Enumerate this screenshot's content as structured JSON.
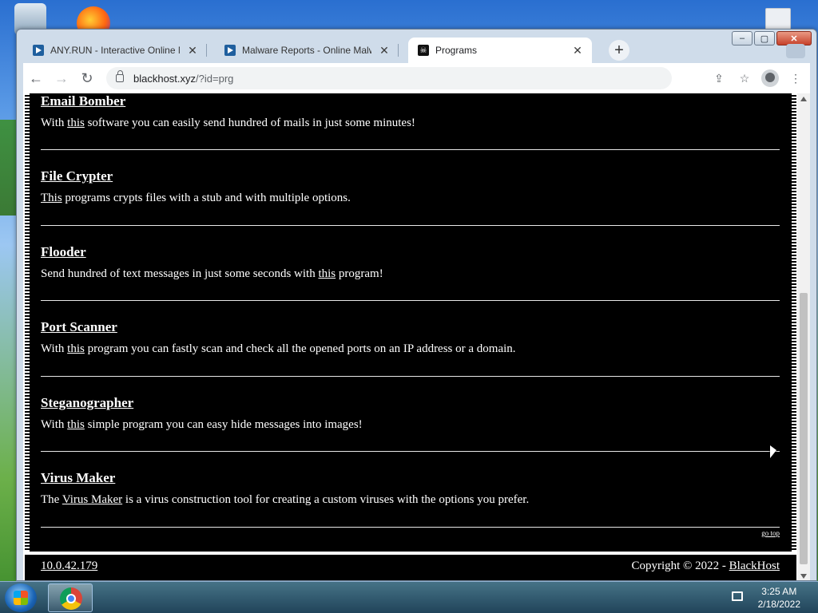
{
  "browser": {
    "tabs": [
      {
        "title": "ANY.RUN - Interactive Online Ma",
        "favicon": "anyrun-icon",
        "active": false
      },
      {
        "title": "Malware Reports - Online Malwa",
        "favicon": "anyrun-icon",
        "active": false
      },
      {
        "title": "Programs",
        "favicon": "pirate-flag-icon",
        "active": true
      }
    ],
    "new_tab_symbol": "+",
    "url_host": "blackhost.xyz",
    "url_path": "/?id=prg",
    "window_controls": {
      "minimize": "–",
      "maximize": "▢",
      "close": "✕"
    }
  },
  "page": {
    "entries": [
      {
        "title": "Email Bomber",
        "desc_before": "With ",
        "desc_link": "this",
        "desc_after": " software you can easily send hundred of mails in just some minutes!"
      },
      {
        "title": "File Crypter",
        "desc_before": "",
        "desc_link": "This",
        "desc_after": " programs crypts files with a stub and with multiple options."
      },
      {
        "title": "Flooder",
        "desc_before": "Send hundred of text messages in just some seconds with ",
        "desc_link": "this",
        "desc_after": " program!"
      },
      {
        "title": "Port Scanner",
        "desc_before": "With ",
        "desc_link": "this",
        "desc_after": " program you can fastly scan and check all the opened ports on an IP address or a domain."
      },
      {
        "title": "Steganographer",
        "desc_before": "With ",
        "desc_link": "this",
        "desc_after": " simple program you can easy hide messages into images!"
      },
      {
        "title": "Virus Maker",
        "desc_before": "The ",
        "desc_link": "Virus Maker",
        "desc_after": " is a virus construction tool for creating a custom viruses with the options you prefer."
      }
    ],
    "go_top": "go top",
    "footer_ip": "10.0.42.179",
    "footer_copyright": "Copyright © 2022 - ",
    "footer_brand": "BlackHost"
  },
  "taskbar": {
    "time": "3:25 AM",
    "date": "2/18/2022"
  },
  "colors": {
    "page_bg": "#000000",
    "text": "#ffffff",
    "chrome_frame": "#cfdcea"
  }
}
